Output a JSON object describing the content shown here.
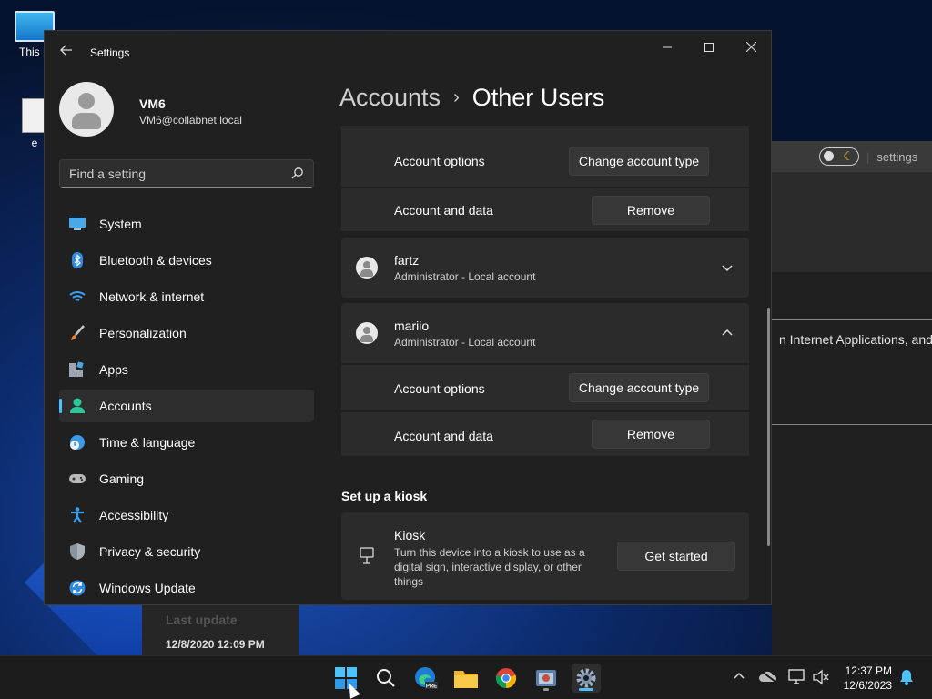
{
  "desktop": {
    "icons": [
      {
        "label": "This P",
        "icon": "monitor-icon"
      },
      {
        "label": "e",
        "icon": "document-icon"
      }
    ]
  },
  "background_window": {
    "tab_label": "settings",
    "text_line": "n Internet Applications, and s"
  },
  "background_window2": {
    "last_update_label": "Last update",
    "timestamp": "12/8/2020 12:09 PM"
  },
  "settings": {
    "window_title": "Settings",
    "profile": {
      "name": "VM6",
      "email": "VM6@collabnet.local"
    },
    "search": {
      "placeholder": "Find a setting"
    },
    "nav": [
      {
        "label": "System",
        "icon": "system-icon"
      },
      {
        "label": "Bluetooth & devices",
        "icon": "bluetooth-icon"
      },
      {
        "label": "Network & internet",
        "icon": "wifi-icon"
      },
      {
        "label": "Personalization",
        "icon": "brush-icon"
      },
      {
        "label": "Apps",
        "icon": "apps-icon"
      },
      {
        "label": "Accounts",
        "icon": "accounts-icon",
        "active": true
      },
      {
        "label": "Time & language",
        "icon": "globe-clock-icon"
      },
      {
        "label": "Gaming",
        "icon": "gamepad-icon"
      },
      {
        "label": "Accessibility",
        "icon": "accessibility-icon"
      },
      {
        "label": "Privacy & security",
        "icon": "shield-icon"
      },
      {
        "label": "Windows Update",
        "icon": "update-icon"
      }
    ],
    "breadcrumb": {
      "parent": "Accounts",
      "separator": "›",
      "current": "Other Users"
    },
    "top_user_options": {
      "account_options_label": "Account options",
      "change_type_button": "Change account type",
      "account_data_label": "Account and data",
      "remove_button": "Remove"
    },
    "users": [
      {
        "name": "fartz",
        "role": "Administrator - Local account",
        "expanded": false
      },
      {
        "name": "mariio",
        "role": "Administrator - Local account",
        "expanded": true,
        "account_options_label": "Account options",
        "change_type_button": "Change account type",
        "account_data_label": "Account and data",
        "remove_button": "Remove"
      }
    ],
    "kiosk": {
      "section_title": "Set up a kiosk",
      "title": "Kiosk",
      "description": "Turn this device into a kiosk to use as a digital sign, interactive display, or other things",
      "button": "Get started"
    }
  },
  "taskbar": {
    "apps": [
      "start-icon",
      "search-icon",
      "edge-pre-icon",
      "file-explorer-icon",
      "chrome-icon",
      "app-icon",
      "settings-gear-icon"
    ],
    "clock": {
      "time": "12:37 PM",
      "date": "12/6/2023"
    }
  },
  "colors": {
    "accent": "#4cc2ff",
    "window_bg": "#202020",
    "card_bg": "#2b2b2b"
  }
}
